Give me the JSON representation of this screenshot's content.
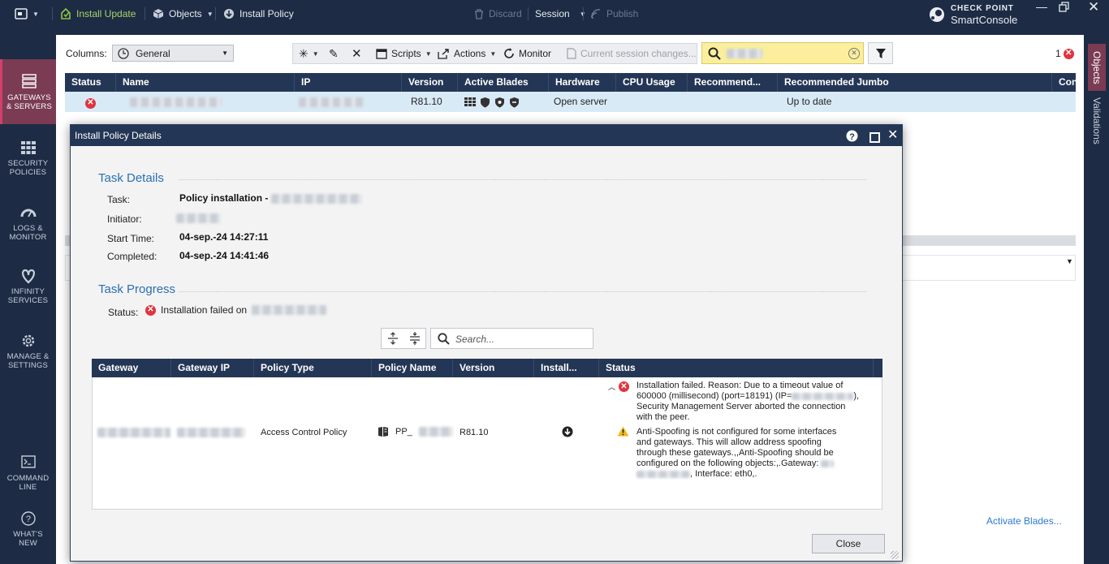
{
  "topbar": {
    "install_update": "Install Update",
    "objects": "Objects",
    "install_policy": "Install Policy",
    "discard": "Discard",
    "session": "Session",
    "publish": "Publish",
    "brand_line1": "CHECK POINT",
    "brand_line2": "SmartConsole"
  },
  "leftnav": [
    {
      "label1": "GATEWAYS",
      "label2": "& SERVERS"
    },
    {
      "label1": "SECURITY",
      "label2": "POLICIES"
    },
    {
      "label1": "LOGS &",
      "label2": "MONITOR"
    },
    {
      "label1": "INFINITY",
      "label2": "SERVICES"
    },
    {
      "label1": "MANAGE &",
      "label2": "SETTINGS"
    },
    {
      "label1": "COMMAND",
      "label2": "LINE"
    },
    {
      "label1": "WHAT'S",
      "label2": "NEW"
    }
  ],
  "rightnav": {
    "objects": "Objects",
    "validations": "Validations"
  },
  "toolbar": {
    "columns_label": "Columns:",
    "columns_value": "General",
    "scripts": "Scripts",
    "actions": "Actions",
    "monitor": "Monitor",
    "session_changes": "Current session changes...",
    "error_count": "1"
  },
  "grid": {
    "headers": [
      "Status",
      "Name",
      "IP",
      "Version",
      "Active Blades",
      "Hardware",
      "CPU Usage",
      "Recommend...",
      "Recommended Jumbo",
      "Con"
    ],
    "row": {
      "version": "R81.10",
      "hardware": "Open server",
      "jumbo": "Up to date"
    }
  },
  "lower_link": "Activate Blades...",
  "dialog": {
    "title": "Install Policy Details",
    "task_details_title": "Task Details",
    "task_label": "Task:",
    "task_value": "Policy installation -",
    "initiator_label": "Initiator:",
    "start_label": "Start Time:",
    "start_value": "04-sep.-24 14:27:11",
    "completed_label": "Completed:",
    "completed_value": "04-sep.-24 14:41:46",
    "progress_title": "Task Progress",
    "status_label": "Status:",
    "status_value": "Installation failed on",
    "search_placeholder": "Search...",
    "table_headers": [
      "Gateway",
      "Gateway IP",
      "Policy Type",
      "Policy Name",
      "Version",
      "Install...",
      "Status"
    ],
    "row": {
      "policy_type": "Access Control Policy",
      "policy_name": "PP_",
      "version": "R81.10"
    },
    "error_lines": [
      "Installation failed. Reason: Due to a timeout value of",
      "600000 (millisecond) (port=18191) (IP=",
      "Security Management Server aborted the connection",
      "with the peer."
    ],
    "error_ip_tail": "),",
    "warning_lines": [
      "Anti-Spoofing is not configured for some interfaces",
      "and gateways. This will allow address spoofing",
      "through these gateways.,,Anti-Spoofing should be",
      "configured on the following objects:,.Gateway:"
    ],
    "warning_tail": ", Interface: eth0,.",
    "close_button": "Close"
  },
  "colors": {
    "nav_bg": "#1d2b44",
    "header_bg": "#243655",
    "active_nav": "#7a3b53",
    "accent_green": "#8bc53f",
    "link_blue": "#2b6fb3",
    "error_red": "#e0343f",
    "warning_yellow": "#f2b81c"
  }
}
